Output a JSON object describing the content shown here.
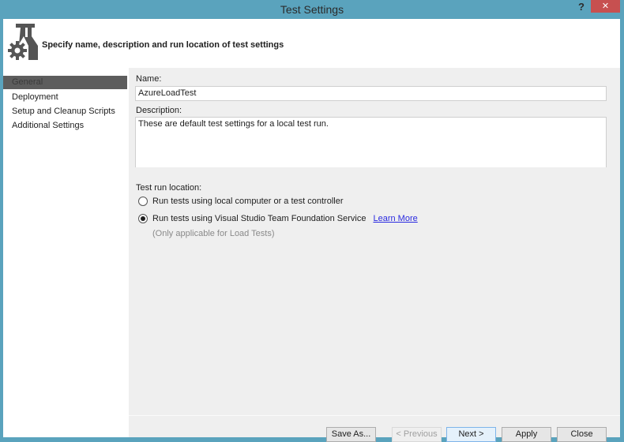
{
  "window": {
    "title": "Test Settings",
    "help_label": "?",
    "close_label": "✕",
    "colors": {
      "frame": "#5aa3bd",
      "close": "#c75050",
      "selected_nav": "#5d5d5d",
      "link": "#2a2ae0"
    }
  },
  "header": {
    "icon": "test-settings-flask-gear-icon",
    "text": "Specify name, description and run location of test settings"
  },
  "sidebar": {
    "items": [
      {
        "label": "General",
        "selected": true
      },
      {
        "label": "Deployment",
        "selected": false
      },
      {
        "label": "Setup and Cleanup Scripts",
        "selected": false
      },
      {
        "label": "Additional Settings",
        "selected": false
      }
    ]
  },
  "form": {
    "name_label": "Name:",
    "name_value": "AzureLoadTest",
    "description_label": "Description:",
    "description_value": "These are default test settings for a local test run.",
    "run_location_label": "Test run location:",
    "options": [
      {
        "label": "Run tests using local computer or a test controller",
        "checked": false
      },
      {
        "label": "Run tests using Visual Studio Team Foundation Service",
        "checked": true
      }
    ],
    "learn_more": "Learn More",
    "note": "(Only applicable for Load Tests)"
  },
  "buttons": {
    "save_as": "Save As...",
    "previous": "< Previous",
    "next": "Next >",
    "apply": "Apply",
    "close": "Close"
  }
}
